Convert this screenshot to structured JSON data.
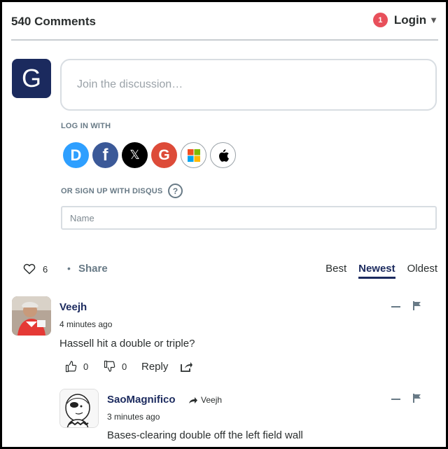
{
  "header": {
    "comment_count": "540 Comments",
    "notification_count": "1",
    "login_label": "Login"
  },
  "composer": {
    "guest_initial": "G",
    "placeholder": "Join the discussion…",
    "log_in_with_label": "LOG IN WITH",
    "sign_up_label": "OR SIGN UP WITH DISQUS",
    "help_glyph": "?",
    "name_placeholder": "Name",
    "providers": [
      {
        "icon": "disqus-icon",
        "glyph": "D",
        "color": "#2e9fff"
      },
      {
        "icon": "facebook-icon",
        "glyph": "f",
        "color": "#3b5998"
      },
      {
        "icon": "x-icon",
        "glyph": "𝕏",
        "color": "#000000"
      },
      {
        "icon": "google-icon",
        "glyph": "G",
        "color": "#dd4b39"
      },
      {
        "icon": "microsoft-icon",
        "glyph": "",
        "color": "#ffffff"
      },
      {
        "icon": "apple-icon",
        "glyph": "",
        "color": "#ffffff"
      }
    ]
  },
  "thread_actions": {
    "like_count": "6",
    "share_label": "Share",
    "sort_tabs": [
      {
        "label": "Best",
        "active": false
      },
      {
        "label": "Newest",
        "active": true
      },
      {
        "label": "Oldest",
        "active": false
      }
    ]
  },
  "comments": [
    {
      "author": "Veejh",
      "time": "4 minutes ago",
      "text": "Hassell hit a double or triple?",
      "upvotes": "0",
      "downvotes": "0",
      "reply_label": "Reply"
    },
    {
      "author": "SaoMagnifico",
      "in_reply_to": "Veejh",
      "time": "3 minutes ago",
      "text": "Bases-clearing double off the left field wall"
    }
  ],
  "colors": {
    "brand_navy": "#1b2a5e",
    "notification_red": "#e8505b",
    "muted_text": "#687a86"
  }
}
